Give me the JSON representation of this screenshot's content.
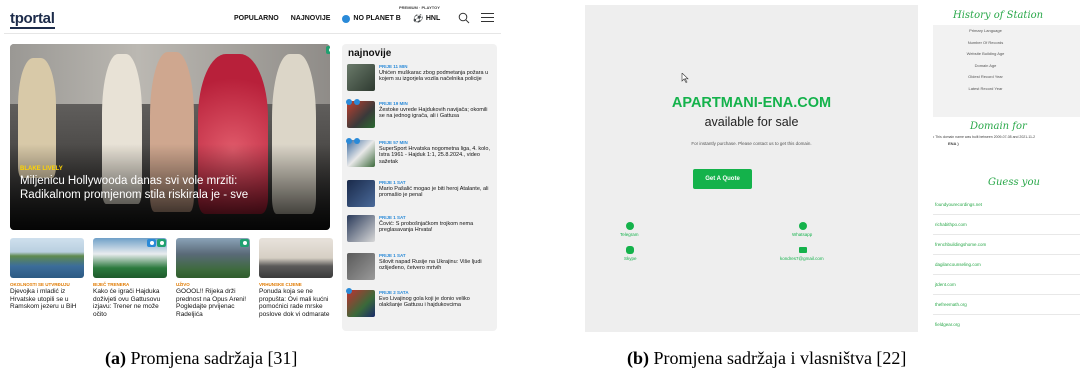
{
  "panel_a": {
    "logo": "tportal",
    "nav": [
      "POPULARNO",
      "NAJNOVIJE",
      "NO PLANET B",
      "HNL"
    ],
    "mini_nav": "PREMIUM · PLAYTOY",
    "hero": {
      "category": "BLAKE LIVELY",
      "title": "Miljenicu Hollywooda danas svi vole mrziti: Radikalnom promjenom stila riskirala je - sve"
    },
    "thumbs": [
      {
        "category": "OKOLNOSTI SE UTVRĐUJU",
        "title": "Djevojka i mladić iz Hrvatske utopili se u Ramskom jezeru u BiH"
      },
      {
        "category": "BIJEČ TRENERA",
        "title": "Kako će igrači Hajduka doživjeti ovu Gattusovu izjavu: Trener ne može očito"
      },
      {
        "category": "UŽIVO",
        "title": "GOOOL!! Rijeka drži prednost na Opus Areni! Pogledajte prvijenac Radeljića"
      },
      {
        "category": "VRHUNSKE CIJENE",
        "title": "Ponuda koja se ne propušta: Ovi mali kućni pomoćnici rade mrske poslove dok vi odmarate"
      }
    ],
    "sidebar": {
      "heading": "najnovije",
      "items": [
        {
          "time": "PRIJE 11 MIN",
          "text": "Uhićen muškarac zbog podmetanja požara u kojem su izgorjela vozila načelnika policije"
        },
        {
          "time": "PRIJE 19 MIN",
          "text": "Žestoke uvrede Hajdukovih navijača; okomili se na jednog igrača, ali i Gattusa"
        },
        {
          "time": "PRIJE 57 MIN",
          "text": "SuperSport Hrvatska nogometna liga, 4. kolo, Istra 1961 - Hajduk 1:1, 25.8.2024., video sažetak"
        },
        {
          "time": "PRIJE 1 SAT",
          "text": "Mario Pašalić mogao je biti heroj Atalante, ali promašio je penal"
        },
        {
          "time": "PRIJE 1 SAT",
          "text": "Čović: S probošnjačkom trojkom nema preglasavanja Hrvata!"
        },
        {
          "time": "PRIJE 1 SAT",
          "text": "Silovit napad Rusije na Ukrajinu: Više ljudi ozlijeđeno, četvero mrtvih"
        },
        {
          "time": "PRIJE 2 SATA",
          "text": "Evo Livajinog gola koji je donio veliko olakšanje Gattusu i hajdukovcima"
        }
      ]
    },
    "caption_letter": "(a)",
    "caption_text": " Promjena sadržaja [31]"
  },
  "panel_b": {
    "domain": "APARTMANI-ENA.COM",
    "available": "available for sale",
    "note": "For instantly purchase. Please contact us to get this domain.",
    "button": "Get A Quote",
    "contacts": [
      {
        "icon": "telegram-icon",
        "label": "Telegram"
      },
      {
        "icon": "whatsapp-icon",
        "label": "Whatsapp"
      },
      {
        "icon": "skype-icon",
        "label": "Skype"
      },
      {
        "icon": "mail-icon",
        "label": "kondres7@gmail.com"
      }
    ],
    "history_title": "History of Station",
    "history_rows": [
      "Primary Language",
      "Number Of Records",
      "Website Building Age",
      "Domain Age",
      "Oldest Record Year",
      "Latest Record Year"
    ],
    "domain_for_title": "Domain for",
    "domain_note": "• This domain name was built between 2009-07-08 and 2021-11-2",
    "domain_note2": "ENA )",
    "guess_title": "Guess you",
    "links": [
      "foundyourecordings.net",
      "richabithpo.com",
      "frenchbuildingshome.com",
      "dagilancounseling.com",
      "jtdent.com",
      "thefreemath.org",
      "fieldgear.org"
    ],
    "caption_letter": "(b)",
    "caption_text": " Promjena sadržaja i vlasništva [22]"
  },
  "colors": {
    "brand_green": "#14b24b",
    "tportal_blue": "#2a8ad8",
    "category_orange": "#e07a00"
  }
}
